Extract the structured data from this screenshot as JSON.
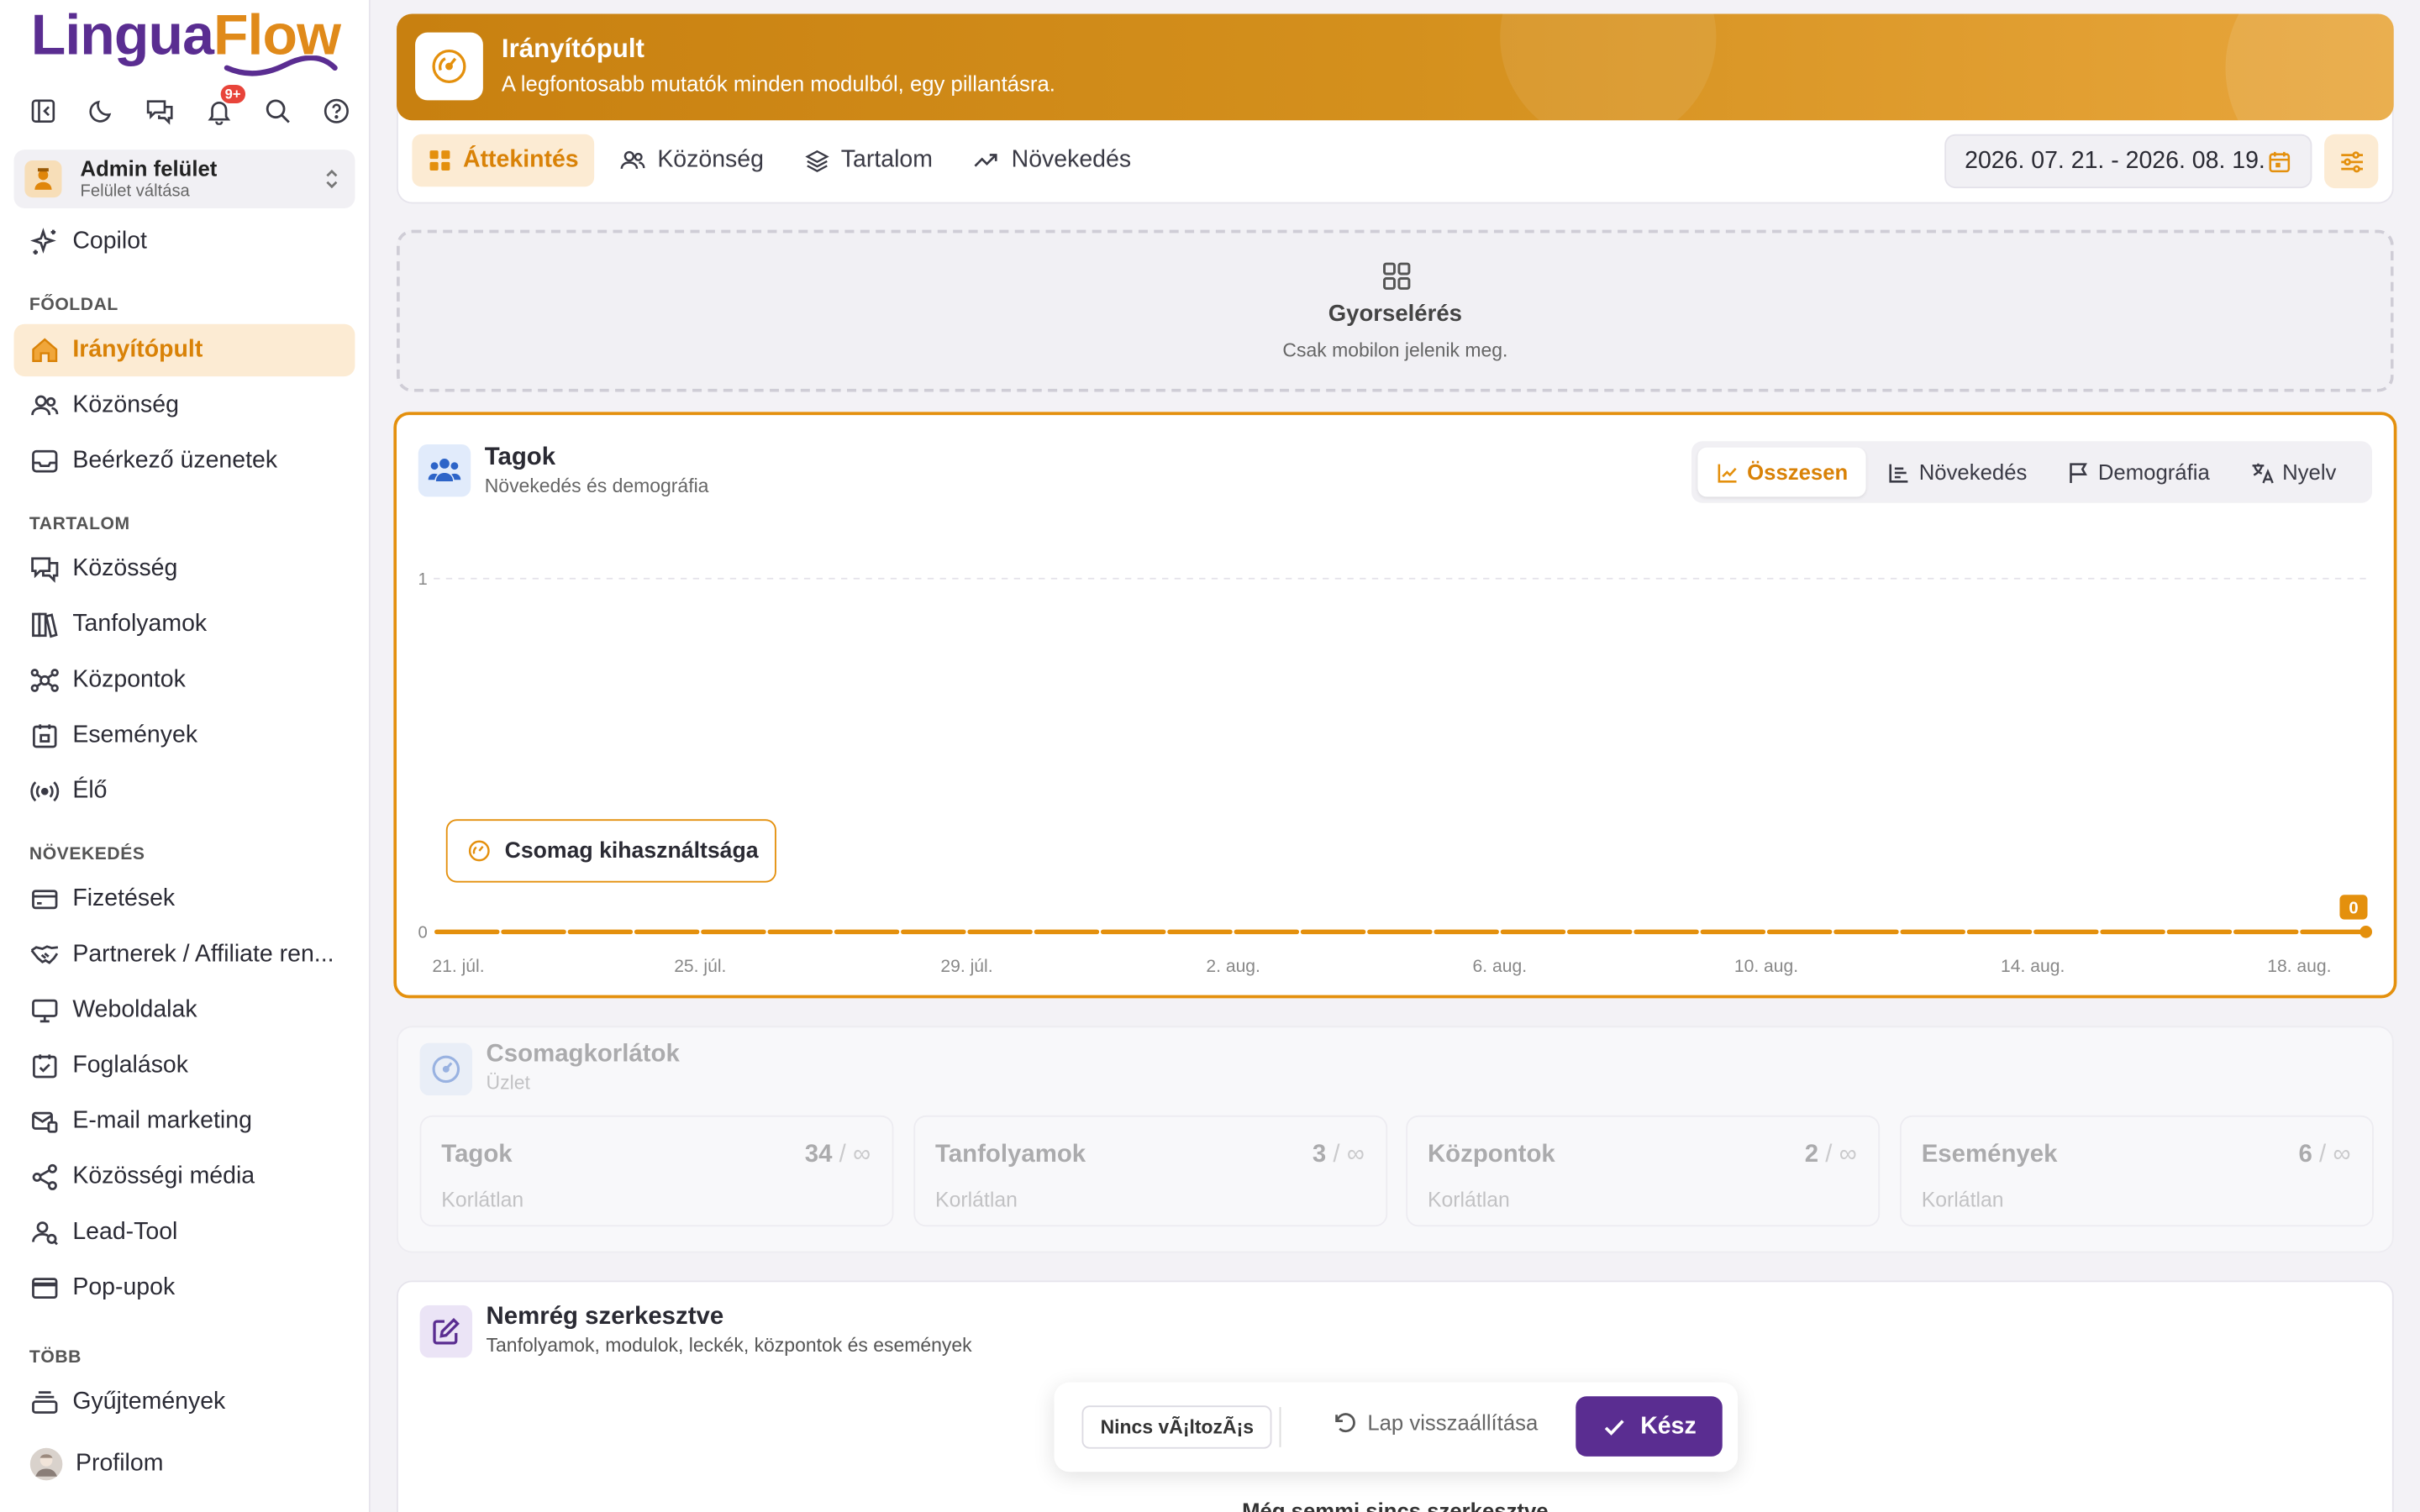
{
  "brand": {
    "part1": "Lingua",
    "part2": "Flow"
  },
  "colors": {
    "accent": "#e4900d",
    "brand_purple": "#5a2d91",
    "active_bg": "#fcebd3",
    "badge": "#e8443a"
  },
  "topbar": {
    "icons": [
      "collapse-sidebar-icon",
      "dark-mode-icon",
      "messages-icon",
      "notifications-icon",
      "search-icon",
      "help-icon"
    ],
    "notification_badge": "9+"
  },
  "switcher": {
    "title": "Admin felület",
    "subtitle": "Felület váltása"
  },
  "nav": {
    "copilot": "Copilot",
    "sections": [
      {
        "title": "FŐOLDAL",
        "items": [
          {
            "label": "Irányítópult",
            "icon": "home-icon",
            "active": true
          },
          {
            "label": "Közönség",
            "icon": "users-icon"
          },
          {
            "label": "Beérkező üzenetek",
            "icon": "inbox-icon"
          }
        ]
      },
      {
        "title": "TARTALOM",
        "items": [
          {
            "label": "Közösség",
            "icon": "chat-icon"
          },
          {
            "label": "Tanfolyamok",
            "icon": "books-icon"
          },
          {
            "label": "Központok",
            "icon": "hub-icon"
          },
          {
            "label": "Események",
            "icon": "calendar-icon"
          },
          {
            "label": "Élő",
            "icon": "broadcast-icon"
          }
        ]
      },
      {
        "title": "NÖVEKEDÉS",
        "items": [
          {
            "label": "Fizetések",
            "icon": "credit-card-icon"
          },
          {
            "label": "Partnerek / Affiliate ren...",
            "icon": "handshake-icon"
          },
          {
            "label": "Weboldalak",
            "icon": "monitor-icon"
          },
          {
            "label": "Foglalások",
            "icon": "calendar-check-icon"
          },
          {
            "label": "E-mail marketing",
            "icon": "mail-icon"
          },
          {
            "label": "Közösségi média",
            "icon": "share-icon"
          },
          {
            "label": "Lead-Tool",
            "icon": "lead-icon"
          },
          {
            "label": "Pop-upok",
            "icon": "popup-icon"
          }
        ]
      },
      {
        "title": "TÖBB",
        "items": [
          {
            "label": "Gyűjtemények",
            "icon": "stack-icon"
          }
        ]
      }
    ],
    "profile": "Profilom"
  },
  "header": {
    "title": "Irányítópult",
    "subtitle": "A legfontosabb mutatók minden modulból, egy pillantásra."
  },
  "tabs": [
    {
      "label": "Áttekintés",
      "icon": "grid-icon",
      "active": true
    },
    {
      "label": "Közönség",
      "icon": "users-icon"
    },
    {
      "label": "Tartalom",
      "icon": "layers-icon"
    },
    {
      "label": "Növekedés",
      "icon": "trend-icon"
    }
  ],
  "date_range": "2026. 07. 21. - 2026. 08. 19.",
  "quick_access": {
    "title": "Gyorselérés",
    "subtitle": "Csak mobilon jelenik meg."
  },
  "members_card": {
    "title": "Tagok",
    "subtitle": "Növekedés és demográfia",
    "segments": [
      {
        "label": "Összesen",
        "icon": "line-chart-icon",
        "active": true
      },
      {
        "label": "Növekedés",
        "icon": "bar-chart-icon"
      },
      {
        "label": "Demográfia",
        "icon": "flag-icon"
      },
      {
        "label": "Nyelv",
        "icon": "translate-icon"
      }
    ],
    "usage_button": "Csomag kihasználtsága"
  },
  "chart_data": {
    "type": "line",
    "title": "",
    "xlabel": "",
    "ylabel": "",
    "x_tick_labels": [
      "21. júl.",
      "25. júl.",
      "29. júl.",
      "2. aug.",
      "6. aug.",
      "10. aug.",
      "14. aug.",
      "18. aug."
    ],
    "y_tick_labels": [
      "0",
      "1"
    ],
    "ylim": [
      0,
      1
    ],
    "grid": true,
    "x": [
      "21. júl.",
      "22. júl.",
      "23. júl.",
      "24. júl.",
      "25. júl.",
      "26. júl.",
      "27. júl.",
      "28. júl.",
      "29. júl.",
      "30. júl.",
      "31. júl.",
      "1. aug.",
      "2. aug.",
      "3. aug.",
      "4. aug.",
      "5. aug.",
      "6. aug.",
      "7. aug.",
      "8. aug.",
      "9. aug.",
      "10. aug.",
      "11. aug.",
      "12. aug.",
      "13. aug.",
      "14. aug.",
      "15. aug.",
      "16. aug.",
      "17. aug.",
      "18. aug.",
      "19. aug."
    ],
    "series": [
      {
        "values": [
          0,
          0,
          0,
          0,
          0,
          0,
          0,
          0,
          0,
          0,
          0,
          0,
          0,
          0,
          0,
          0,
          0,
          0,
          0,
          0,
          0,
          0,
          0,
          0,
          0,
          0,
          0,
          0,
          0,
          0
        ]
      }
    ],
    "end_label": "0",
    "color": "#e4900d"
  },
  "limits": {
    "title": "Csomagkorlátok",
    "subtitle": "Üzlet",
    "items": [
      {
        "name": "Tagok",
        "value": "34",
        "limit": "∞",
        "status": "Korlátlan"
      },
      {
        "name": "Tanfolyamok",
        "value": "3",
        "limit": "∞",
        "status": "Korlátlan"
      },
      {
        "name": "Központok",
        "value": "2",
        "limit": "∞",
        "status": "Korlátlan"
      },
      {
        "name": "Események",
        "value": "6",
        "limit": "∞",
        "status": "Korlátlan"
      }
    ]
  },
  "recent": {
    "title": "Nemrég szerkesztve",
    "subtitle": "Tanfolyamok, modulok, leckék, központok és események",
    "empty": "Még semmi sincs szerkesztve"
  },
  "bottom_bar": {
    "status": "Nincs vÃ¡ltozÃ¡s",
    "reset": "Lap visszaállítása",
    "done": "Kész"
  }
}
